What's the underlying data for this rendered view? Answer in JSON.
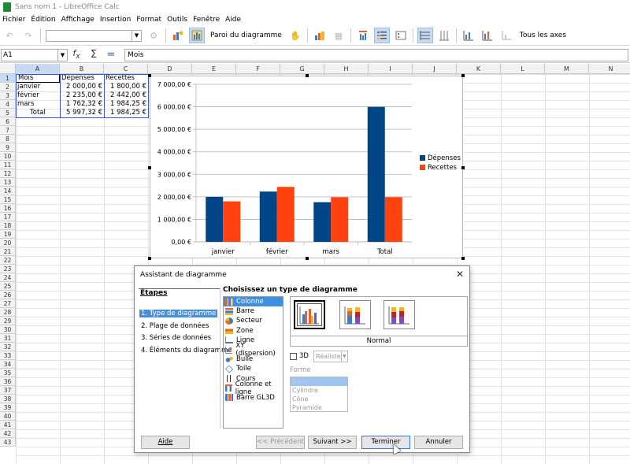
{
  "window": {
    "title": "Sans nom 1 - LibreOffice Calc"
  },
  "menu": [
    "Fichier",
    "Édition",
    "Affichage",
    "Insertion",
    "Format",
    "Outils",
    "Fenêtre",
    "Aide"
  ],
  "toolbar": {
    "wall_label": "Paroi du diagramme",
    "all_axes_label": "Tous les axes"
  },
  "formula": {
    "cell_ref": "A1",
    "content": "Mois"
  },
  "columns": [
    "A",
    "B",
    "C",
    "D",
    "E",
    "F",
    "G",
    "H",
    "I",
    "J",
    "K",
    "L",
    "M",
    "N"
  ],
  "rows": [
    "1",
    "2",
    "3",
    "4",
    "5",
    "6",
    "7",
    "8",
    "9",
    "10",
    "11",
    "12",
    "13",
    "14",
    "15",
    "16",
    "17",
    "18",
    "19",
    "20",
    "21",
    "22",
    "23",
    "24",
    "25",
    "26",
    "27",
    "28",
    "29",
    "30",
    "31",
    "32",
    "33",
    "34",
    "35",
    "36",
    "37",
    "38",
    "39",
    "40",
    "41",
    "42",
    "43"
  ],
  "sheet": {
    "headers": [
      "Mois",
      "Dépenses",
      "Recettes"
    ],
    "rows": [
      [
        "janvier",
        "2 000,00 €",
        "1 800,00 €"
      ],
      [
        "février",
        "2 235,00 €",
        "2 442,00 €"
      ],
      [
        "mars",
        "1 762,32 €",
        "1 984,25 €"
      ],
      [
        "Total",
        "5 997,32 €",
        "1 984,25 €"
      ]
    ]
  },
  "chart_data": {
    "type": "bar",
    "categories": [
      "janvier",
      "février",
      "mars",
      "Total"
    ],
    "series": [
      {
        "name": "Dépenses",
        "values": [
          2000,
          2235,
          1762.32,
          5997.32
        ],
        "color": "#004586"
      },
      {
        "name": "Recettes",
        "values": [
          1800,
          2442,
          1984.25,
          1984.25
        ],
        "color": "#ff420e"
      }
    ],
    "ylim": [
      0,
      7000
    ],
    "yticks": [
      "0,00 €",
      "1 000,00 €",
      "2 000,00 €",
      "3 000,00 €",
      "4 000,00 €",
      "5 000,00 €",
      "6 000,00 €",
      "7 000,00 €"
    ],
    "legend": "right",
    "grid": true
  },
  "dialog": {
    "title": "Assistant de diagramme",
    "steps_title": "Étapes",
    "steps": [
      "1. Type de diagramme",
      "2. Plage de données",
      "3. Séries de données",
      "4. Éléments du diagramme"
    ],
    "choose_label": "Choisissez un type de diagramme",
    "types": [
      {
        "label": "Colonne",
        "icon": "column-chart-icon"
      },
      {
        "label": "Barre",
        "icon": "bar-chart-icon"
      },
      {
        "label": "Secteur",
        "icon": "pie-chart-icon"
      },
      {
        "label": "Zone",
        "icon": "area-chart-icon"
      },
      {
        "label": "Ligne",
        "icon": "line-chart-icon"
      },
      {
        "label": "XY (dispersion)",
        "icon": "scatter-chart-icon"
      },
      {
        "label": "Bulle",
        "icon": "bubble-chart-icon"
      },
      {
        "label": "Toile",
        "icon": "net-chart-icon"
      },
      {
        "label": "Cours",
        "icon": "stock-chart-icon"
      },
      {
        "label": "Colonne et ligne",
        "icon": "column-line-chart-icon"
      },
      {
        "label": "Barre GL3D",
        "icon": "gl3d-bar-chart-icon"
      }
    ],
    "variant_label": "Normal",
    "three_d_label": "3D",
    "look_value": "Réaliste",
    "shape_label": "Forme",
    "shapes": [
      "Barre",
      "Cylindre",
      "Cône",
      "Pyramide"
    ],
    "buttons": {
      "help": "Aide",
      "prev": "<< Précédent",
      "next": "Suivant >>",
      "finish": "Terminer",
      "cancel": "Annuler"
    }
  }
}
